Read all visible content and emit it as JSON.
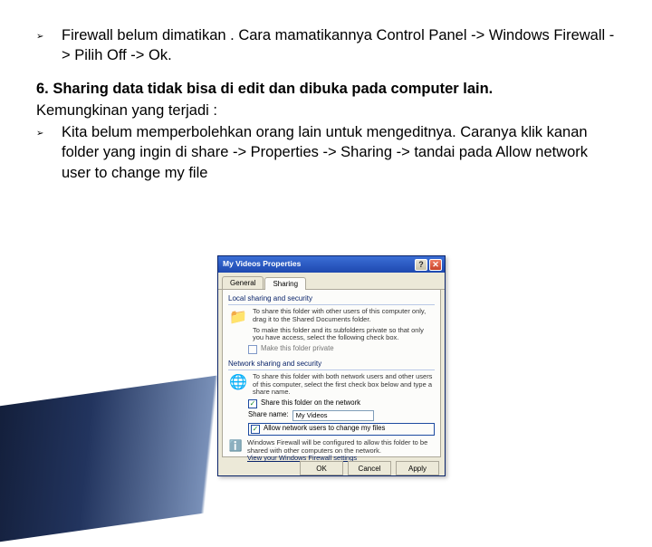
{
  "body": {
    "bullet1": "Firewall belum dimatikan . Cara mamatikannya Control Panel -> Windows Firewall -> Pilih Off  -> Ok.",
    "heading": "6. Sharing data tidak bisa di edit dan dibuka pada computer lain.",
    "subline": "Kemungkinan yang terjadi :",
    "bullet2": "Kita belum memperbolehkan orang lain untuk mengeditnya. Caranya klik kanan folder yang ingin di share -> Properties -> Sharing -> tandai pada Allow network user to change my file",
    "arrow": "➢"
  },
  "dialog": {
    "title": "My Videos Properties",
    "help": "?",
    "close": "✕",
    "tabs": {
      "general": "General",
      "sharing": "Sharing"
    },
    "local": {
      "title": "Local sharing and security",
      "desc": "To share this folder with other users of this computer only, drag it to the Shared Documents folder.",
      "desc2": "To make this folder and its subfolders private so that only you have access, select the following check box.",
      "chkPrivate": "Make this folder private"
    },
    "net": {
      "title": "Network sharing and security",
      "desc": "To share this folder with both network users and other users of this computer, select the first check box below and type a share name.",
      "chkShare": "Share this folder on the network",
      "shareLabel": "Share name:",
      "shareValue": "My Videos",
      "chkAllow": "Allow network users to change my files"
    },
    "warn": {
      "text": "Windows Firewall will be configured to allow this folder to be shared with other computers on the network.",
      "link": "View your Windows Firewall settings"
    },
    "buttons": {
      "ok": "OK",
      "cancel": "Cancel",
      "apply": "Apply"
    }
  }
}
